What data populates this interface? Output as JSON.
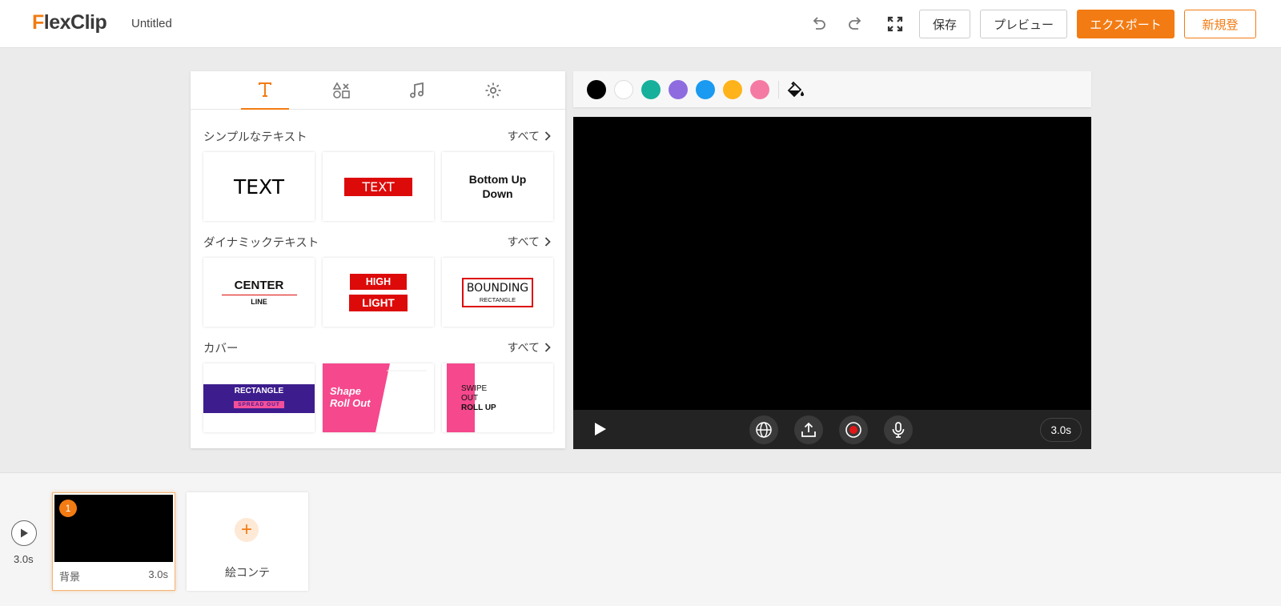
{
  "header": {
    "logo": "FlexClip",
    "project_title": "Untitled",
    "save_label": "保存",
    "preview_label": "プレビュー",
    "export_label": "エクスポート",
    "signup_label": "新規登"
  },
  "sections": {
    "simple": {
      "title": "シンプルなテキスト",
      "all": "すべて",
      "cards": [
        "TEXT",
        "TEXT",
        "Bottom Up Down"
      ]
    },
    "dynamic": {
      "title": "ダイナミックテキスト",
      "all": "すべて",
      "cards": {
        "center": "CENTER",
        "line": "LINE",
        "high": "HIGH",
        "light": "LIGHT",
        "bounding": "BOUNDING",
        "rectangle": "RECTANGLE"
      }
    },
    "cover": {
      "title": "カバー",
      "all": "すべて",
      "cards": {
        "rect_main": "RECTANGLE",
        "rect_sub": "SPREAD OUT",
        "shape1": "Shape",
        "shape2": "Roll Out",
        "swipe1": "SWIPE",
        "swipe2": "OUT",
        "swipe3": "ROLL UP"
      }
    }
  },
  "swatches": [
    "#000000",
    "#ffffff",
    "#16b09b",
    "#8e6cdf",
    "#1a9af0",
    "#ffb31a",
    "#f57aa3"
  ],
  "player": {
    "duration": "3.0s"
  },
  "timeline": {
    "total_time": "3.0s",
    "scene": {
      "number": "1",
      "name": "背景",
      "duration": "3.0s"
    },
    "add_label": "絵コンテ"
  }
}
